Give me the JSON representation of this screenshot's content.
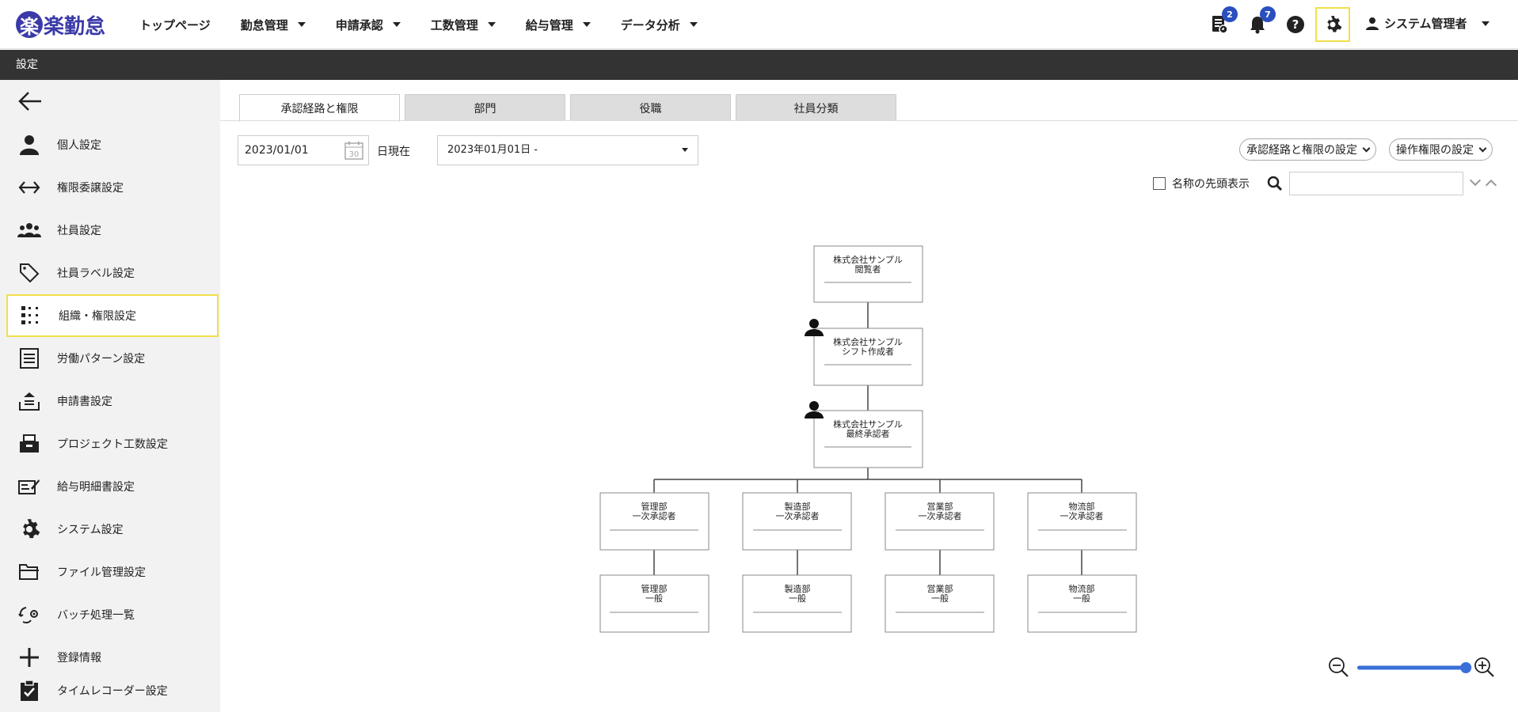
{
  "app": {
    "logo_glyph": "楽",
    "logo_text": "楽勤怠",
    "brand_color": "#3b3aa8",
    "accent_highlight": "#f0e04a"
  },
  "nav": {
    "items": [
      {
        "label": "トップページ",
        "has_dropdown": false
      },
      {
        "label": "勤怠管理",
        "has_dropdown": true
      },
      {
        "label": "申請承認",
        "has_dropdown": true
      },
      {
        "label": "工数管理",
        "has_dropdown": true
      },
      {
        "label": "給与管理",
        "has_dropdown": true
      },
      {
        "label": "データ分析",
        "has_dropdown": true
      }
    ]
  },
  "header_icons": {
    "requests_badge": "2",
    "notifications_badge": "7",
    "user_name": "システム管理者"
  },
  "subbar": {
    "title": "設定"
  },
  "sidebar": {
    "items": [
      {
        "label": "個人設定",
        "icon": "person-icon"
      },
      {
        "label": "権限委譲設定",
        "icon": "arrows-horizontal-icon"
      },
      {
        "label": "社員設定",
        "icon": "people-icon"
      },
      {
        "label": "社員ラベル設定",
        "icon": "tag-icon"
      },
      {
        "label": "組織・権限設定",
        "icon": "org-grid-icon",
        "active": true
      },
      {
        "label": "労働パターン設定",
        "icon": "list-icon"
      },
      {
        "label": "申請書設定",
        "icon": "tray-icon"
      },
      {
        "label": "プロジェクト工数設定",
        "icon": "project-icon"
      },
      {
        "label": "給与明細書設定",
        "icon": "payslip-icon"
      },
      {
        "label": "システム設定",
        "icon": "gear-icon"
      },
      {
        "label": "ファイル管理設定",
        "icon": "folder-icon"
      },
      {
        "label": "バッチ処理一覧",
        "icon": "batch-icon"
      },
      {
        "label": "登録情報",
        "icon": "plus-icon"
      },
      {
        "label": "タイムレコーダー設定",
        "icon": "clipboard-check-icon"
      }
    ]
  },
  "tabs": [
    {
      "label": "承認経路と権限",
      "active": true
    },
    {
      "label": "部門",
      "active": false
    },
    {
      "label": "役職",
      "active": false
    },
    {
      "label": "社員分類",
      "active": false
    }
  ],
  "filters": {
    "date_value": "2023/01/01",
    "calendar_day": "30",
    "date_suffix": "日現在",
    "period_value": "2023年01月01日 -"
  },
  "actions": {
    "route_settings": "承認経路と権限の設定",
    "permission_settings": "操作権限の設定",
    "name_prefix_label": "名称の先頭表示",
    "search_placeholder": ""
  },
  "org": {
    "root": {
      "line1": "株式会社サンプル",
      "line2": "閲覧者"
    },
    "level2": {
      "line1": "株式会社サンプル",
      "line2": "シフト作成者"
    },
    "level3": {
      "line1": "株式会社サンプル",
      "line2": "最終承認者"
    },
    "branches": [
      {
        "approver": {
          "line1": "管理部",
          "line2": "一次承認者"
        },
        "member": {
          "line1": "管理部",
          "line2": "一般"
        }
      },
      {
        "approver": {
          "line1": "製造部",
          "line2": "一次承認者"
        },
        "member": {
          "line1": "製造部",
          "line2": "一般"
        }
      },
      {
        "approver": {
          "line1": "営業部",
          "line2": "一次承認者"
        },
        "member": {
          "line1": "営業部",
          "line2": "一般"
        }
      },
      {
        "approver": {
          "line1": "物流部",
          "line2": "一次承認者"
        },
        "member": {
          "line1": "物流部",
          "line2": "一般"
        }
      }
    ]
  },
  "zoom": {
    "level": 0.98
  }
}
